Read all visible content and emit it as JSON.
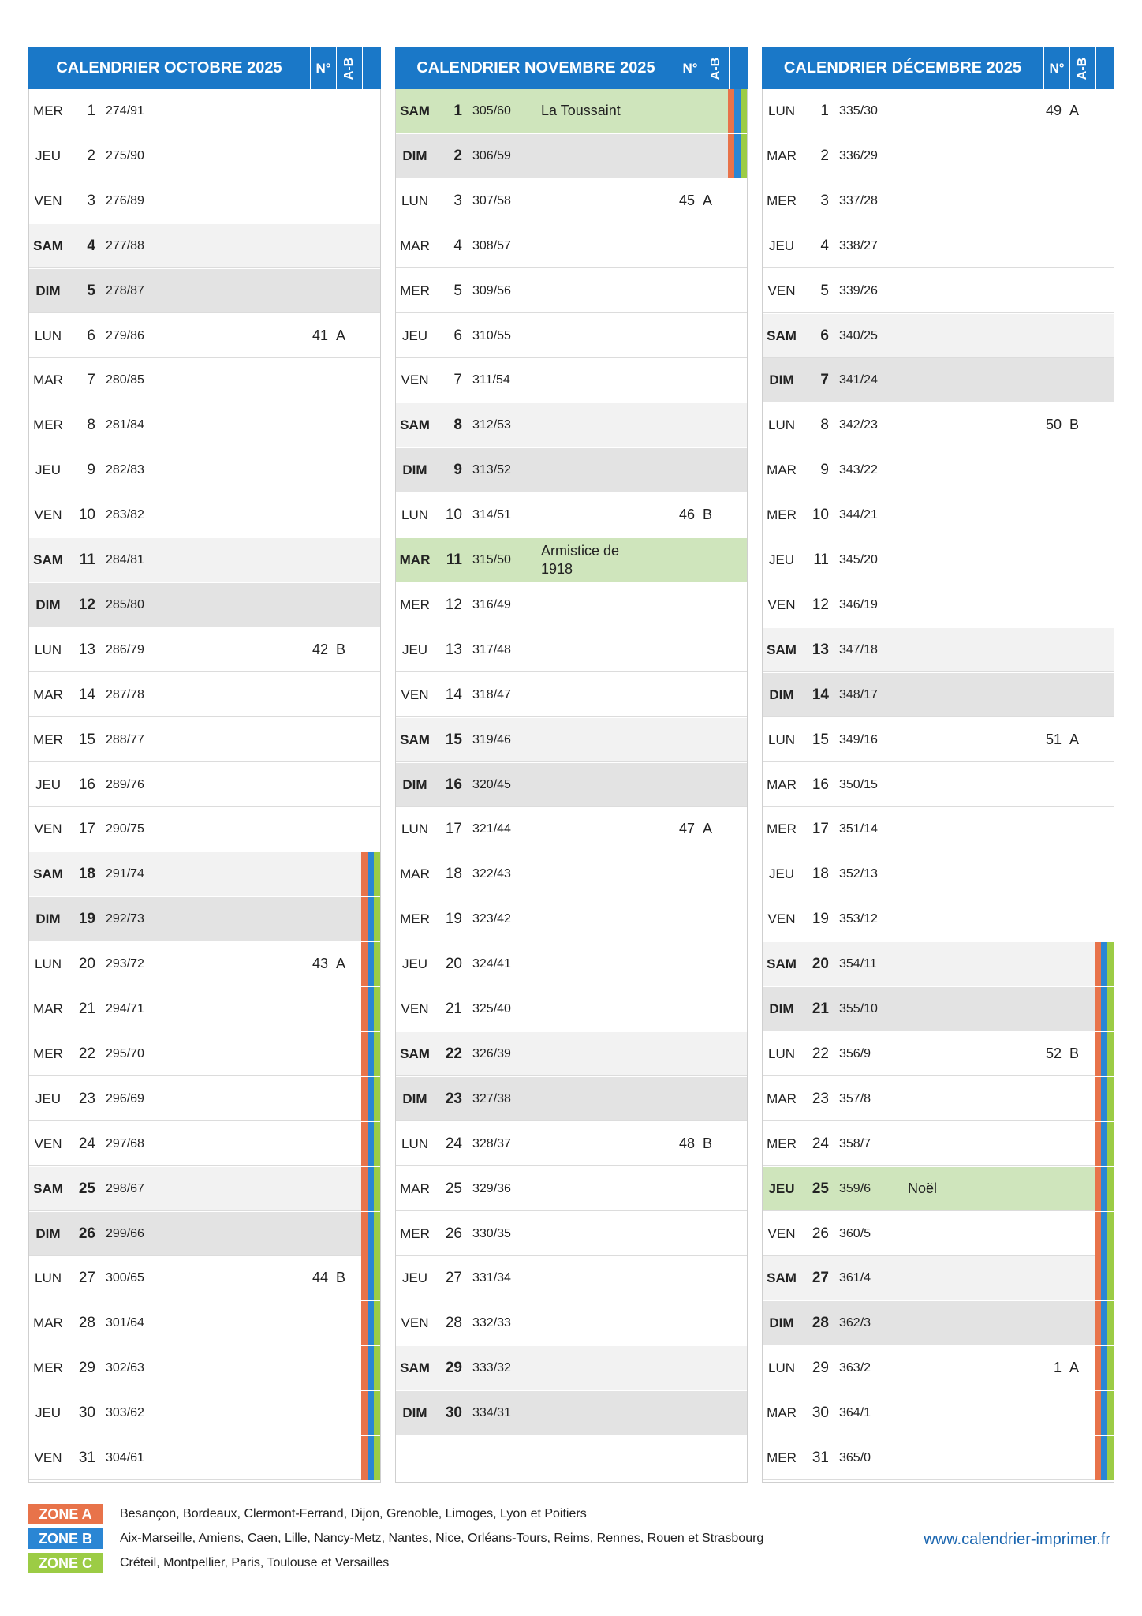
{
  "colors": {
    "header": "#1a78c8",
    "zone_a": "#e8734a",
    "zone_b": "#2a86d4",
    "zone_c": "#9ccc45",
    "holiday": "#cfe5bc"
  },
  "months": [
    {
      "title": "CALENDRIER OCTOBRE 2025",
      "no_label": "N°",
      "ab_label": "A-B",
      "days": [
        {
          "d": "MER",
          "n": "1",
          "c": "274/91"
        },
        {
          "d": "JEU",
          "n": "2",
          "c": "275/90"
        },
        {
          "d": "VEN",
          "n": "3",
          "c": "276/89"
        },
        {
          "d": "SAM",
          "n": "4",
          "c": "277/88",
          "type": "sat"
        },
        {
          "d": "DIM",
          "n": "5",
          "c": "278/87",
          "type": "sun"
        },
        {
          "d": "LUN",
          "n": "6",
          "c": "279/86",
          "wk": "41",
          "ab": "A"
        },
        {
          "d": "MAR",
          "n": "7",
          "c": "280/85"
        },
        {
          "d": "MER",
          "n": "8",
          "c": "281/84"
        },
        {
          "d": "JEU",
          "n": "9",
          "c": "282/83"
        },
        {
          "d": "VEN",
          "n": "10",
          "c": "283/82"
        },
        {
          "d": "SAM",
          "n": "11",
          "c": "284/81",
          "type": "sat"
        },
        {
          "d": "DIM",
          "n": "12",
          "c": "285/80",
          "type": "sun"
        },
        {
          "d": "LUN",
          "n": "13",
          "c": "286/79",
          "wk": "42",
          "ab": "B"
        },
        {
          "d": "MAR",
          "n": "14",
          "c": "287/78"
        },
        {
          "d": "MER",
          "n": "15",
          "c": "288/77"
        },
        {
          "d": "JEU",
          "n": "16",
          "c": "289/76"
        },
        {
          "d": "VEN",
          "n": "17",
          "c": "290/75"
        },
        {
          "d": "SAM",
          "n": "18",
          "c": "291/74",
          "type": "sat",
          "zones": true
        },
        {
          "d": "DIM",
          "n": "19",
          "c": "292/73",
          "type": "sun",
          "zones": true
        },
        {
          "d": "LUN",
          "n": "20",
          "c": "293/72",
          "wk": "43",
          "ab": "A",
          "zones": true
        },
        {
          "d": "MAR",
          "n": "21",
          "c": "294/71",
          "zones": true
        },
        {
          "d": "MER",
          "n": "22",
          "c": "295/70",
          "zones": true
        },
        {
          "d": "JEU",
          "n": "23",
          "c": "296/69",
          "zones": true
        },
        {
          "d": "VEN",
          "n": "24",
          "c": "297/68",
          "zones": true
        },
        {
          "d": "SAM",
          "n": "25",
          "c": "298/67",
          "type": "sat",
          "zones": true
        },
        {
          "d": "DIM",
          "n": "26",
          "c": "299/66",
          "type": "sun",
          "zones": true
        },
        {
          "d": "LUN",
          "n": "27",
          "c": "300/65",
          "wk": "44",
          "ab": "B",
          "zones": true
        },
        {
          "d": "MAR",
          "n": "28",
          "c": "301/64",
          "zones": true
        },
        {
          "d": "MER",
          "n": "29",
          "c": "302/63",
          "zones": true
        },
        {
          "d": "JEU",
          "n": "30",
          "c": "303/62",
          "zones": true
        },
        {
          "d": "VEN",
          "n": "31",
          "c": "304/61",
          "zones": true
        }
      ]
    },
    {
      "title": "CALENDRIER NOVEMBRE 2025",
      "no_label": "N°",
      "ab_label": "A-B",
      "days": [
        {
          "d": "SAM",
          "n": "1",
          "c": "305/60",
          "type": "holiday",
          "bold": true,
          "hol": "La Toussaint",
          "zones": true
        },
        {
          "d": "DIM",
          "n": "2",
          "c": "306/59",
          "type": "sun",
          "zones": true
        },
        {
          "d": "LUN",
          "n": "3",
          "c": "307/58",
          "wk": "45",
          "ab": "A"
        },
        {
          "d": "MAR",
          "n": "4",
          "c": "308/57"
        },
        {
          "d": "MER",
          "n": "5",
          "c": "309/56"
        },
        {
          "d": "JEU",
          "n": "6",
          "c": "310/55"
        },
        {
          "d": "VEN",
          "n": "7",
          "c": "311/54"
        },
        {
          "d": "SAM",
          "n": "8",
          "c": "312/53",
          "type": "sat"
        },
        {
          "d": "DIM",
          "n": "9",
          "c": "313/52",
          "type": "sun"
        },
        {
          "d": "LUN",
          "n": "10",
          "c": "314/51",
          "wk": "46",
          "ab": "B"
        },
        {
          "d": "MAR",
          "n": "11",
          "c": "315/50",
          "type": "holiday",
          "bold": true,
          "hol": "Armistice de 1918"
        },
        {
          "d": "MER",
          "n": "12",
          "c": "316/49"
        },
        {
          "d": "JEU",
          "n": "13",
          "c": "317/48"
        },
        {
          "d": "VEN",
          "n": "14",
          "c": "318/47"
        },
        {
          "d": "SAM",
          "n": "15",
          "c": "319/46",
          "type": "sat"
        },
        {
          "d": "DIM",
          "n": "16",
          "c": "320/45",
          "type": "sun"
        },
        {
          "d": "LUN",
          "n": "17",
          "c": "321/44",
          "wk": "47",
          "ab": "A"
        },
        {
          "d": "MAR",
          "n": "18",
          "c": "322/43"
        },
        {
          "d": "MER",
          "n": "19",
          "c": "323/42"
        },
        {
          "d": "JEU",
          "n": "20",
          "c": "324/41"
        },
        {
          "d": "VEN",
          "n": "21",
          "c": "325/40"
        },
        {
          "d": "SAM",
          "n": "22",
          "c": "326/39",
          "type": "sat"
        },
        {
          "d": "DIM",
          "n": "23",
          "c": "327/38",
          "type": "sun"
        },
        {
          "d": "LUN",
          "n": "24",
          "c": "328/37",
          "wk": "48",
          "ab": "B"
        },
        {
          "d": "MAR",
          "n": "25",
          "c": "329/36"
        },
        {
          "d": "MER",
          "n": "26",
          "c": "330/35"
        },
        {
          "d": "JEU",
          "n": "27",
          "c": "331/34"
        },
        {
          "d": "VEN",
          "n": "28",
          "c": "332/33"
        },
        {
          "d": "SAM",
          "n": "29",
          "c": "333/32",
          "type": "sat"
        },
        {
          "d": "DIM",
          "n": "30",
          "c": "334/31",
          "type": "sun"
        }
      ]
    },
    {
      "title": "CALENDRIER DÉCEMBRE 2025",
      "no_label": "N°",
      "ab_label": "A-B",
      "days": [
        {
          "d": "LUN",
          "n": "1",
          "c": "335/30",
          "wk": "49",
          "ab": "A"
        },
        {
          "d": "MAR",
          "n": "2",
          "c": "336/29"
        },
        {
          "d": "MER",
          "n": "3",
          "c": "337/28"
        },
        {
          "d": "JEU",
          "n": "4",
          "c": "338/27"
        },
        {
          "d": "VEN",
          "n": "5",
          "c": "339/26"
        },
        {
          "d": "SAM",
          "n": "6",
          "c": "340/25",
          "type": "sat"
        },
        {
          "d": "DIM",
          "n": "7",
          "c": "341/24",
          "type": "sun"
        },
        {
          "d": "LUN",
          "n": "8",
          "c": "342/23",
          "wk": "50",
          "ab": "B"
        },
        {
          "d": "MAR",
          "n": "9",
          "c": "343/22"
        },
        {
          "d": "MER",
          "n": "10",
          "c": "344/21"
        },
        {
          "d": "JEU",
          "n": "11",
          "c": "345/20"
        },
        {
          "d": "VEN",
          "n": "12",
          "c": "346/19"
        },
        {
          "d": "SAM",
          "n": "13",
          "c": "347/18",
          "type": "sat"
        },
        {
          "d": "DIM",
          "n": "14",
          "c": "348/17",
          "type": "sun"
        },
        {
          "d": "LUN",
          "n": "15",
          "c": "349/16",
          "wk": "51",
          "ab": "A"
        },
        {
          "d": "MAR",
          "n": "16",
          "c": "350/15"
        },
        {
          "d": "MER",
          "n": "17",
          "c": "351/14"
        },
        {
          "d": "JEU",
          "n": "18",
          "c": "352/13"
        },
        {
          "d": "VEN",
          "n": "19",
          "c": "353/12"
        },
        {
          "d": "SAM",
          "n": "20",
          "c": "354/11",
          "type": "sat",
          "zones": true
        },
        {
          "d": "DIM",
          "n": "21",
          "c": "355/10",
          "type": "sun",
          "zones": true
        },
        {
          "d": "LUN",
          "n": "22",
          "c": "356/9",
          "wk": "52",
          "ab": "B",
          "zones": true
        },
        {
          "d": "MAR",
          "n": "23",
          "c": "357/8",
          "zones": true
        },
        {
          "d": "MER",
          "n": "24",
          "c": "358/7",
          "zones": true
        },
        {
          "d": "JEU",
          "n": "25",
          "c": "359/6",
          "type": "holiday",
          "bold": true,
          "hol": "Noël",
          "zones": true
        },
        {
          "d": "VEN",
          "n": "26",
          "c": "360/5",
          "zones": true
        },
        {
          "d": "SAM",
          "n": "27",
          "c": "361/4",
          "type": "sat",
          "zones": true
        },
        {
          "d": "DIM",
          "n": "28",
          "c": "362/3",
          "type": "sun",
          "zones": true
        },
        {
          "d": "LUN",
          "n": "29",
          "c": "363/2",
          "wk": "1",
          "ab": "A",
          "zones": true
        },
        {
          "d": "MAR",
          "n": "30",
          "c": "364/1",
          "zones": true
        },
        {
          "d": "MER",
          "n": "31",
          "c": "365/0",
          "zones": true
        }
      ]
    }
  ],
  "legend": [
    {
      "zone": "ZONE A",
      "text": "Besançon, Bordeaux, Clermont-Ferrand, Dijon, Grenoble, Limoges, Lyon et Poitiers",
      "color": "#e8734a"
    },
    {
      "zone": "ZONE B",
      "text": "Aix-Marseille, Amiens, Caen, Lille, Nancy-Metz, Nantes, Nice, Orléans-Tours, Reims, Rennes, Rouen et Strasbourg",
      "color": "#2a86d4"
    },
    {
      "zone": "ZONE C",
      "text": "Créteil, Montpellier, Paris, Toulouse et Versailles",
      "color": "#9ccc45"
    }
  ],
  "website": "www.calendrier-imprimer.fr"
}
